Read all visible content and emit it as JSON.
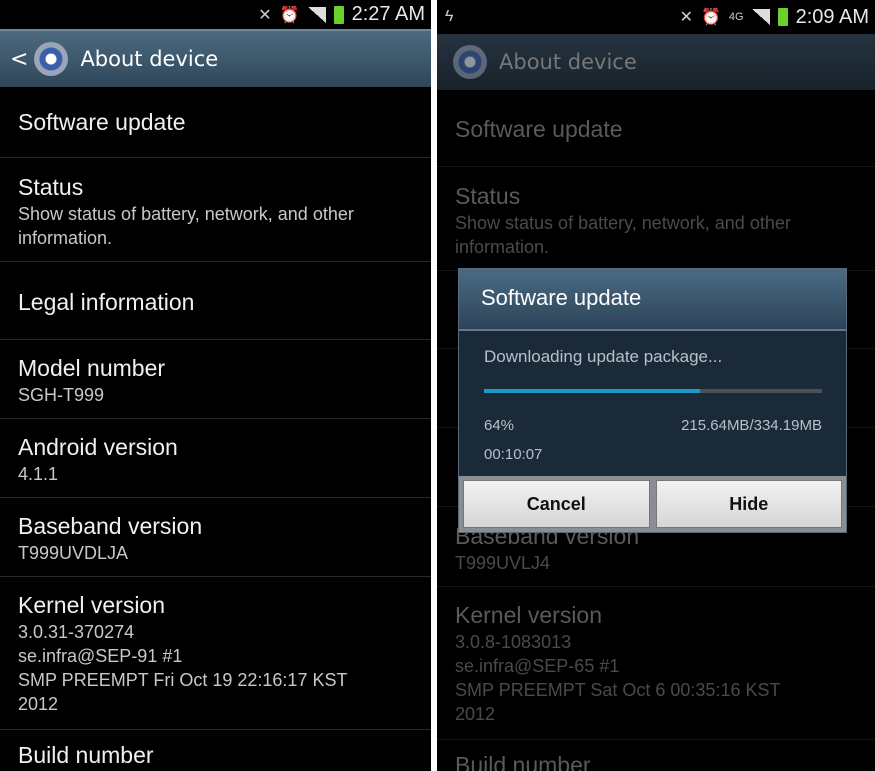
{
  "left": {
    "status_bar": {
      "time": "2:27 AM",
      "icons": [
        "mute-icon",
        "alarm-icon",
        "signal-icon",
        "battery-charging-icon"
      ]
    },
    "header": {
      "title": "About device"
    },
    "rows": [
      {
        "title": "Software update"
      },
      {
        "title": "Status",
        "subtitle": "Show status of battery, network, and other information."
      },
      {
        "title": "Legal information"
      },
      {
        "title": "Model number",
        "value": "SGH-T999"
      },
      {
        "title": "Android version",
        "value": "4.1.1"
      },
      {
        "title": "Baseband version",
        "value": "T999UVDLJA"
      },
      {
        "title": "Kernel version",
        "value_lines": [
          "3.0.31-370274",
          "se.infra@SEP-91 #1",
          "SMP PREEMPT Fri Oct 19 22:16:17 KST",
          "2012"
        ]
      },
      {
        "title": "Build number"
      }
    ]
  },
  "right": {
    "status_bar": {
      "time": "2:09 AM",
      "network": "4G",
      "icons": [
        "usb-debug-icon",
        "mute-icon",
        "alarm-icon",
        "4g-data-icon",
        "signal-icon",
        "battery-charging-icon"
      ]
    },
    "header": {
      "title": "About device"
    },
    "rows": [
      {
        "title": "Software update"
      },
      {
        "title": "Status",
        "subtitle": "Show status of battery, network, and other information."
      },
      {
        "title": "Baseband version",
        "value": "T999UVLJ4"
      },
      {
        "title": "Kernel version",
        "value_lines": [
          "3.0.8-1083013",
          "se.infra@SEP-65 #1",
          "SMP PREEMPT Sat Oct 6 00:35:16 KST",
          "2012"
        ]
      },
      {
        "title": "Build number"
      }
    ],
    "dialog": {
      "title": "Software update",
      "message": "Downloading update package...",
      "progress_percent": 64,
      "percent_label": "64%",
      "size": "215.64MB/334.19MB",
      "elapsed": "00:10:07",
      "cancel_label": "Cancel",
      "hide_label": "Hide",
      "accent": "#1e9ac8"
    }
  }
}
